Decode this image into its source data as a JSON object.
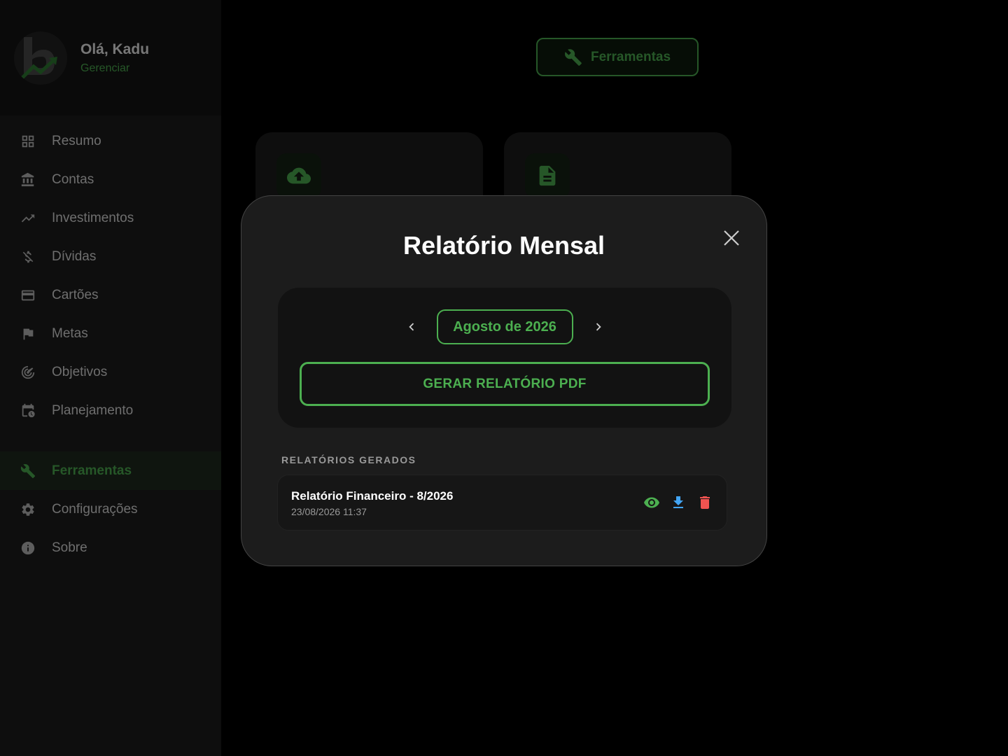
{
  "user": {
    "greeting": "Olá, Kadu",
    "manage_label": "Gerenciar"
  },
  "sidebar": {
    "items": [
      {
        "label": "Resumo",
        "icon": "grid-icon"
      },
      {
        "label": "Contas",
        "icon": "bank-icon"
      },
      {
        "label": "Investimentos",
        "icon": "trending-up-icon"
      },
      {
        "label": "Dívidas",
        "icon": "money-off-icon"
      },
      {
        "label": "Cartões",
        "icon": "credit-card-icon"
      },
      {
        "label": "Metas",
        "icon": "flag-icon"
      },
      {
        "label": "Objetivos",
        "icon": "target-icon"
      },
      {
        "label": "Planejamento",
        "icon": "calendar-clock-icon"
      }
    ],
    "bottom_items": [
      {
        "label": "Ferramentas",
        "icon": "wrench-icon",
        "active": true
      },
      {
        "label": "Configurações",
        "icon": "gear-icon"
      },
      {
        "label": "Sobre",
        "icon": "info-icon"
      }
    ]
  },
  "header": {
    "tools_button_label": "Ferramentas"
  },
  "background_cards": [
    {
      "icon": "cloud-upload-icon"
    },
    {
      "icon": "document-icon"
    }
  ],
  "modal": {
    "title": "Relatório Mensal",
    "month_label": "Agosto de 2026",
    "generate_button_label": "GERAR RELATÓRIO PDF",
    "section_title": "RELATÓRIOS GERADOS",
    "reports": [
      {
        "title": "Relatório Financeiro - 8/2026",
        "date": "23/08/2026 11:37"
      }
    ]
  },
  "colors": {
    "accent": "#4caf50",
    "download": "#42a5f5",
    "delete": "#ef5350"
  }
}
